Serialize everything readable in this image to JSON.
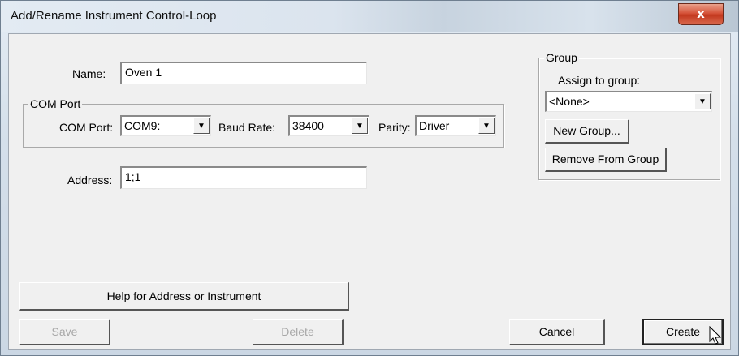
{
  "window": {
    "title": "Add/Rename Instrument Control-Loop",
    "close_label": "x"
  },
  "name_field": {
    "label": "Name:",
    "value": "Oven 1"
  },
  "com_port_group": {
    "legend": "COM Port",
    "com_port": {
      "label": "COM Port:",
      "value": "COM9:"
    },
    "baud_rate": {
      "label": "Baud Rate:",
      "value": "38400"
    },
    "parity": {
      "label": "Parity:",
      "value": "Driver"
    }
  },
  "address_field": {
    "label": "Address:",
    "value": "1;1"
  },
  "group_box": {
    "legend": "Group",
    "assign_label": "Assign to group:",
    "assign_value": "<None>",
    "new_group_label": "New Group...",
    "remove_label": "Remove From Group"
  },
  "buttons": {
    "help": "Help for Address or  Instrument",
    "save": "Save",
    "delete": "Delete",
    "cancel": "Cancel",
    "create": "Create"
  },
  "icons": {
    "dropdown": "chevron-down-icon",
    "close": "close-icon",
    "cursor": "mouse-pointer-icon"
  }
}
